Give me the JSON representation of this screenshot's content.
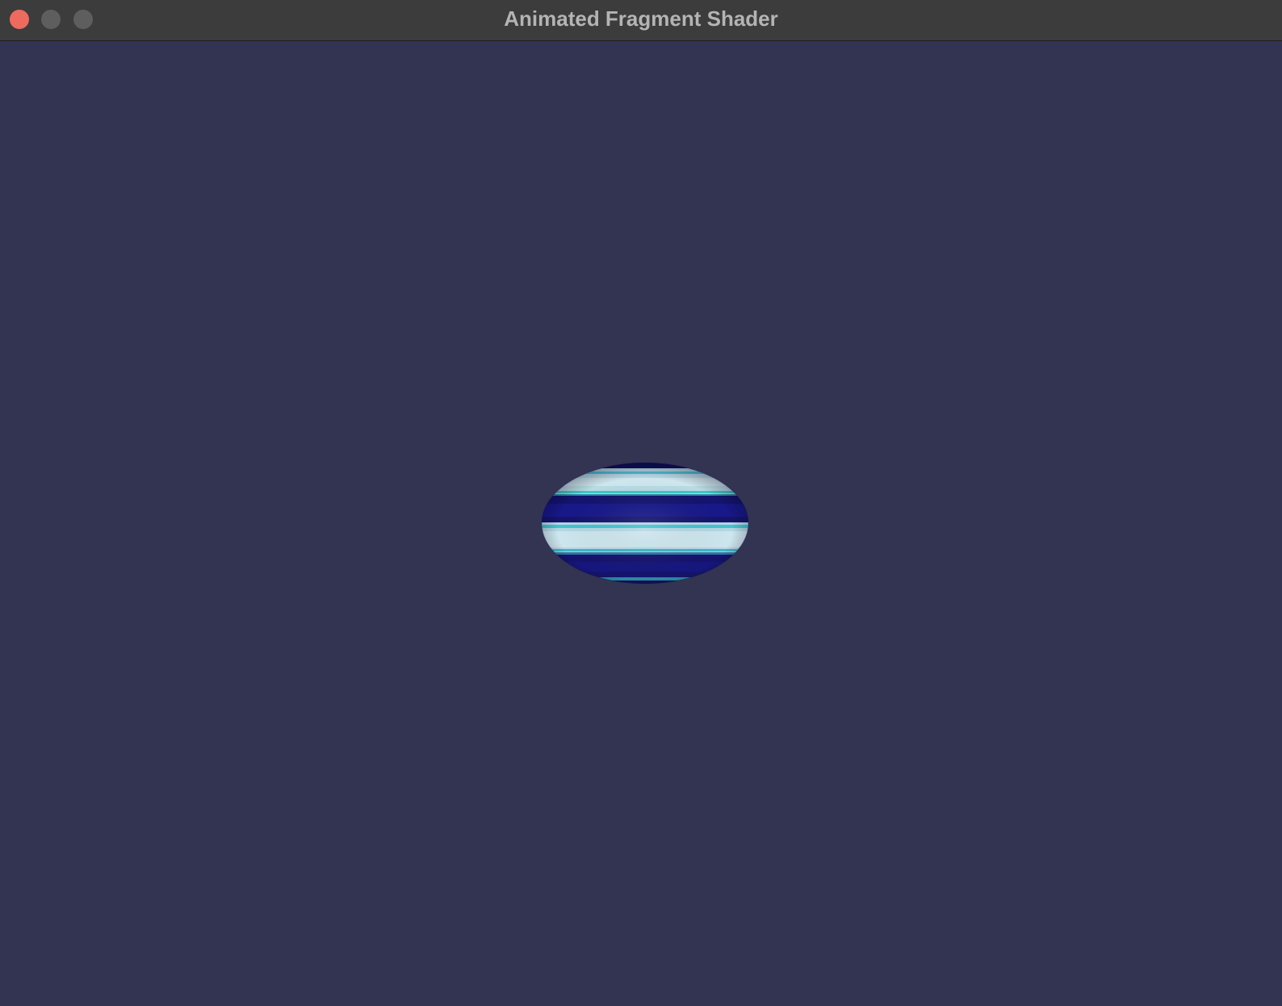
{
  "window": {
    "title": "Animated Fragment Shader",
    "controls": {
      "close_icon": "close-icon",
      "minimize_icon": "minimize-icon",
      "zoom_icon": "zoom-icon"
    }
  },
  "colors": {
    "background": "#333352",
    "titlebar": "#3c3c3c",
    "title_text": "#b4b4b4",
    "close": "#ee6a5e",
    "inactive_control": "#5e5e5e",
    "stripe_dark": "#14146e",
    "stripe_light": "#b4dce6",
    "stripe_accent": "#3cc8c8"
  }
}
